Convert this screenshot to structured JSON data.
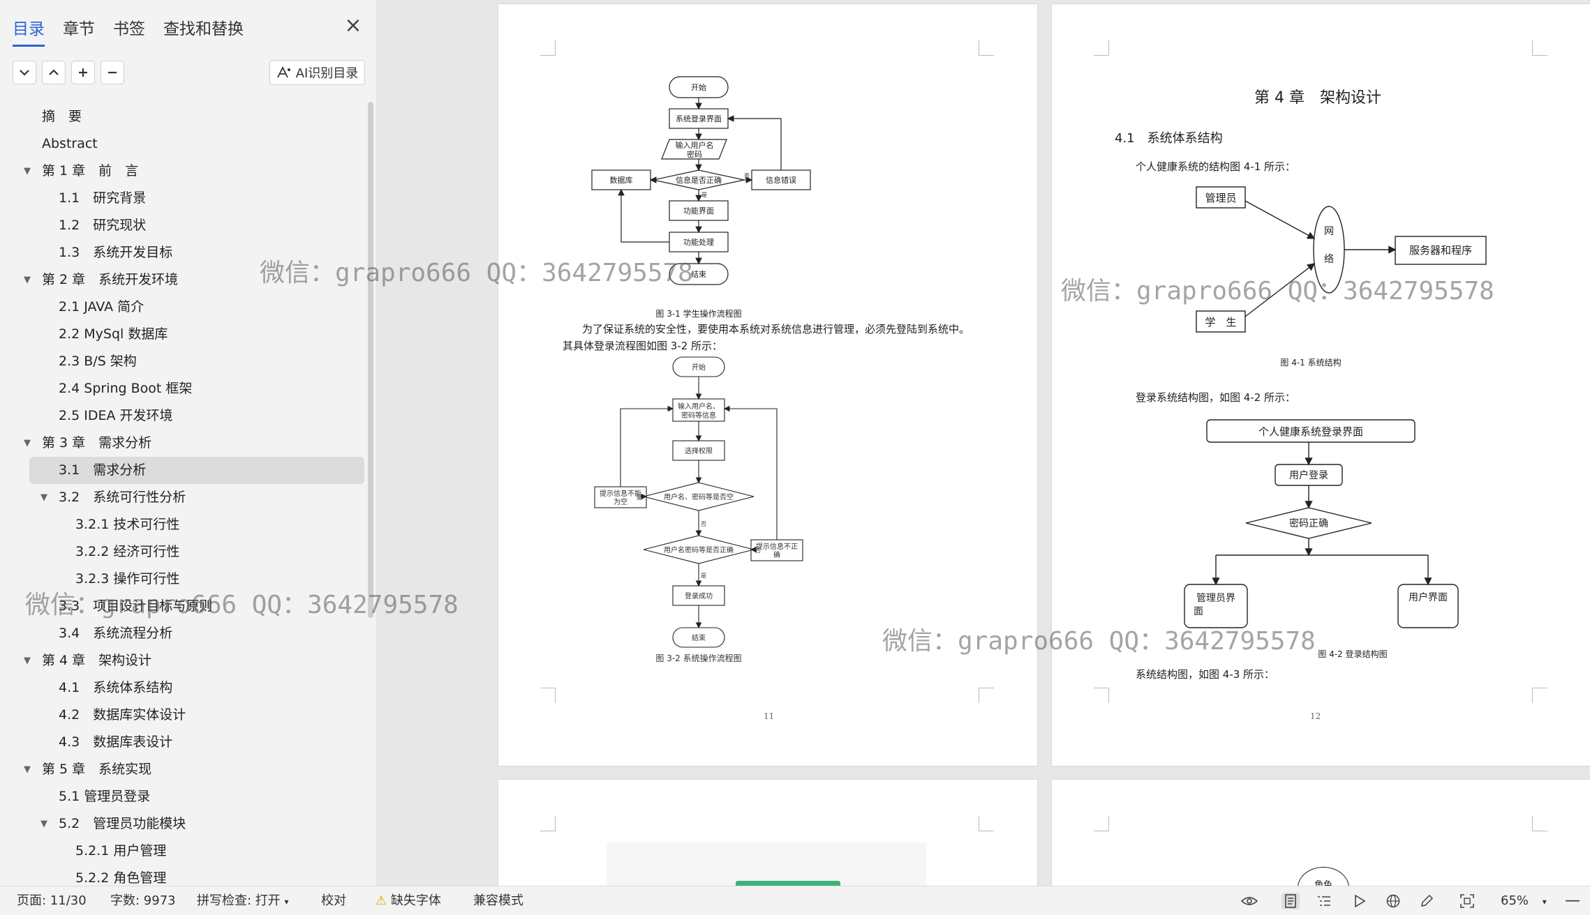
{
  "sidebar": {
    "tabs": [
      "目录",
      "章节",
      "书签",
      "查找和替换"
    ],
    "ai_button": "AI识别目录",
    "toc": [
      {
        "label": "摘　要",
        "level": 0,
        "expand": false
      },
      {
        "label": "Abstract",
        "level": 0,
        "expand": false
      },
      {
        "label": "第 1 章　前　言",
        "level": 0,
        "expand": true
      },
      {
        "label": "1.1　研究背景",
        "level": 1,
        "expand": false
      },
      {
        "label": "1.2　研究现状",
        "level": 1,
        "expand": false
      },
      {
        "label": "1.3　系统开发目标",
        "level": 1,
        "expand": false
      },
      {
        "label": "第 2 章　系统开发环境",
        "level": 0,
        "expand": true
      },
      {
        "label": "2.1 JAVA 简介",
        "level": 1,
        "expand": false
      },
      {
        "label": "2.2 MySql 数据库",
        "level": 1,
        "expand": false
      },
      {
        "label": "2.3 B/S 架构",
        "level": 1,
        "expand": false
      },
      {
        "label": "2.4 Spring Boot 框架",
        "level": 1,
        "expand": false
      },
      {
        "label": "2.5 IDEA 开发环境",
        "level": 1,
        "expand": false
      },
      {
        "label": "第 3 章　需求分析",
        "level": 0,
        "expand": true
      },
      {
        "label": "3.1　需求分析",
        "level": 1,
        "expand": false,
        "selected": true
      },
      {
        "label": "3.2　系统可行性分析",
        "level": 1,
        "expand": true
      },
      {
        "label": "3.2.1 技术可行性",
        "level": 2,
        "expand": false
      },
      {
        "label": "3.2.2 经济可行性",
        "level": 2,
        "expand": false
      },
      {
        "label": "3.2.3 操作可行性",
        "level": 2,
        "expand": false
      },
      {
        "label": "3.3　项目设计目标与原则",
        "level": 1,
        "expand": false
      },
      {
        "label": "3.4　系统流程分析",
        "level": 1,
        "expand": false
      },
      {
        "label": "第 4 章　架构设计",
        "level": 0,
        "expand": true
      },
      {
        "label": "4.1　系统体系结构",
        "level": 1,
        "expand": false
      },
      {
        "label": "4.2　数据库实体设计",
        "level": 1,
        "expand": false
      },
      {
        "label": "4.3　数据库表设计",
        "level": 1,
        "expand": false
      },
      {
        "label": "第 5 章　系统实现",
        "level": 0,
        "expand": true
      },
      {
        "label": "5.1 管理员登录",
        "level": 1,
        "expand": false
      },
      {
        "label": "5.2　管理员功能模块",
        "level": 1,
        "expand": true
      },
      {
        "label": "5.2.1 用户管理",
        "level": 2,
        "expand": false
      },
      {
        "label": "5.2.2 角色管理",
        "level": 2,
        "expand": false
      }
    ]
  },
  "page11": {
    "flow1": {
      "start": "开始",
      "login": "系统登录界面",
      "input": "输入用户名\n密码",
      "check": "信息是否正确",
      "db": "数据库",
      "error": "信息错误",
      "func_ui": "功能界面",
      "func_proc": "功能处理",
      "end": "结束",
      "no": "否",
      "yes": "是",
      "caption": "图 3-1  学生操作流程图"
    },
    "para1": "为了保证系统的安全性，要使用本系统对系统信息进行管理，必须先登陆到系统中。",
    "para2": "其具体登录流程图如图 3-2 所示：",
    "flow2": {
      "start": "开始",
      "input": "输入用户名、\n密码等信息",
      "perm": "选择权限",
      "empty_q": "用户名、密码等是否空",
      "empty_msg": "提示信息不能\n为空",
      "correct_q": "用户名密码等是否正确",
      "wrong_msg": "提示信息不正\n确",
      "success": "登录成功",
      "end": "结束",
      "yes": "是",
      "no": "否",
      "caption": "图 3-2  系统操作流程图"
    },
    "page_number": "11"
  },
  "page12": {
    "chapter_title": "第 4 章　架构设计",
    "section_title": "4.1　系统体系结构",
    "intro": "个人健康系统的结构图 4-1 所示：",
    "arch": {
      "admin": "管理员",
      "student": "学　生",
      "net1": "网",
      "net2": "络",
      "server": "服务器和程序",
      "caption": "图 4-1  系统结构"
    },
    "intro2": "登录系统结构图，如图 4-2 所示：",
    "login_struct": {
      "top": "个人健康系统登录界面",
      "user_login": "用户登录",
      "pwd": "密码正确",
      "admin_ui": "管理员界\n面",
      "user_ui": "用户界面",
      "caption": "图 4-2  登录结构图"
    },
    "intro3": "系统结构图，如图 4-3 所示：",
    "page_number": "12"
  },
  "page13": {
    "partial_label": "角色"
  },
  "watermark": "微信：grapro666 QQ：3642795578",
  "statusbar": {
    "page": "页面: 11/30",
    "words": "字数: 9973",
    "spell": "拼写检查: 打开",
    "proof": "校对",
    "missing_font": "缺失字体",
    "compat": "兼容模式",
    "zoom": "65%"
  },
  "colors": {
    "accent": "#2b64d4",
    "warning": "#e6a000",
    "green_bar": "#3db37a"
  }
}
